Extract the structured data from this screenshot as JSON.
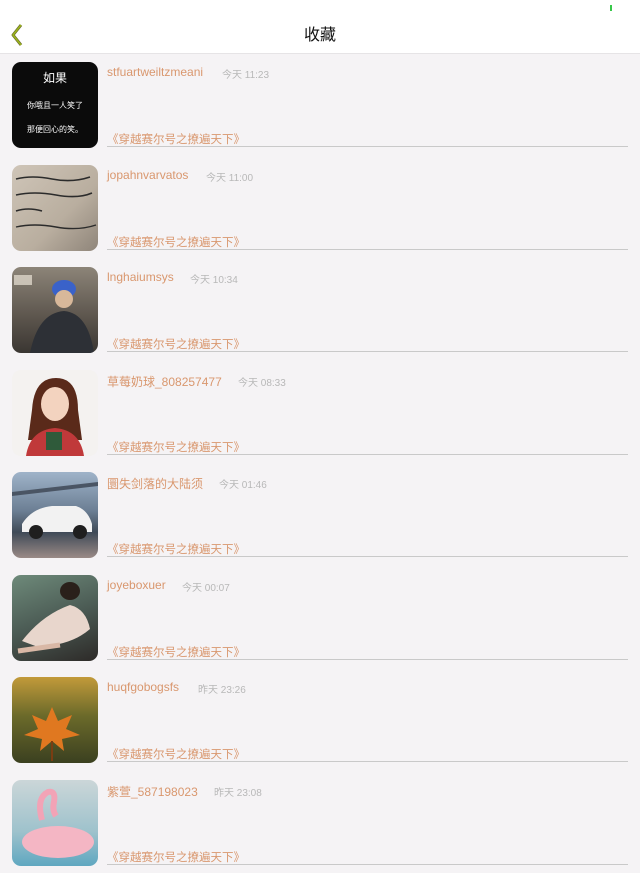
{
  "header": {
    "title": "收藏",
    "back_icon": "chevron-left-icon",
    "accent": "#7a9a18"
  },
  "colors": {
    "name": "#d9976e",
    "time": "#b8b8b8",
    "battery": "#38c84a"
  },
  "favorites": [
    {
      "username": "stfuartweiltzmeani",
      "time": "今天 11:23",
      "book": "《穿越赛尔号之撩遍天下》",
      "avatar": "text-quote-avatar",
      "avatar_text": [
        "如果",
        "你哦且一人笑了",
        "那便回心的笑。"
      ]
    },
    {
      "username": "jopahnvarvatos",
      "time": "今天 11:00",
      "book": "《穿越赛尔号之撩遍天下》",
      "avatar": "handwriting-avatar"
    },
    {
      "username": "lnghaiumsys",
      "time": "今天 10:34",
      "book": "《穿越赛尔号之撩遍天下》",
      "avatar": "person-blue-cap-avatar"
    },
    {
      "username": "草莓奶球_808257477",
      "time": "今天 08:33",
      "book": "《穿越赛尔号之撩遍天下》",
      "avatar": "anime-girl-avatar"
    },
    {
      "username": "圜失剑落的大陆须",
      "time": "今天 01:46",
      "book": "《穿越赛尔号之撩遍天下》",
      "avatar": "white-car-avatar"
    },
    {
      "username": "joyeboxuer",
      "time": "今天 00:07",
      "book": "《穿越赛尔号之撩遍天下》",
      "avatar": "lounging-woman-avatar"
    },
    {
      "username": "huqfgobogsfs",
      "time": "昨天 23:26",
      "book": "《穿越赛尔号之撩遍天下》",
      "avatar": "maple-leaf-avatar"
    },
    {
      "username": "紫萱_587198023",
      "time": "昨天 23:08",
      "book": "《穿越赛尔号之撩遍天下》",
      "avatar": "flamingo-float-avatar"
    }
  ]
}
